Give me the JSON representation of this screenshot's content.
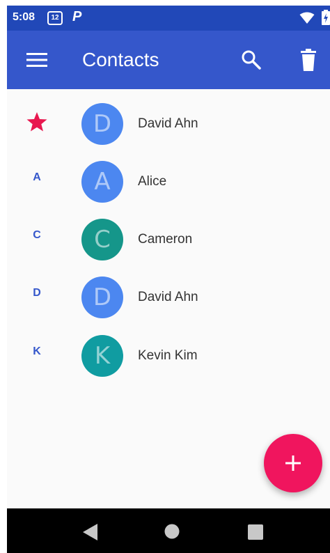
{
  "status_bar": {
    "time": "5:08",
    "notification_count": "12",
    "app_icon": "p-icon",
    "icons": [
      "wifi-icon",
      "battery-icon"
    ]
  },
  "app_bar": {
    "title": "Contacts",
    "menu_icon": "menu-icon",
    "search_icon": "search-icon",
    "delete_icon": "delete-icon",
    "color": "#3557cb"
  },
  "contacts": [
    {
      "section": "starred",
      "initial": "D",
      "name": "David Ahn",
      "avatar_color": "#4c87f0"
    },
    {
      "section": "A",
      "initial": "A",
      "name": "Alice",
      "avatar_color": "#4c87f0"
    },
    {
      "section": "C",
      "initial": "C",
      "name": "Cameron",
      "avatar_color": "#15968a"
    },
    {
      "section": "D",
      "initial": "D",
      "name": "David Ahn",
      "avatar_color": "#4c87f0"
    },
    {
      "section": "K",
      "initial": "K",
      "name": "Kevin Kim",
      "avatar_color": "#109ca1"
    }
  ],
  "fab": {
    "icon": "add-icon",
    "color": "#f0155e"
  },
  "nav_bar": {
    "icons": [
      "back-icon",
      "home-icon",
      "recents-icon"
    ]
  },
  "colors": {
    "accent": "#3557cb",
    "star": "#e8184f"
  }
}
